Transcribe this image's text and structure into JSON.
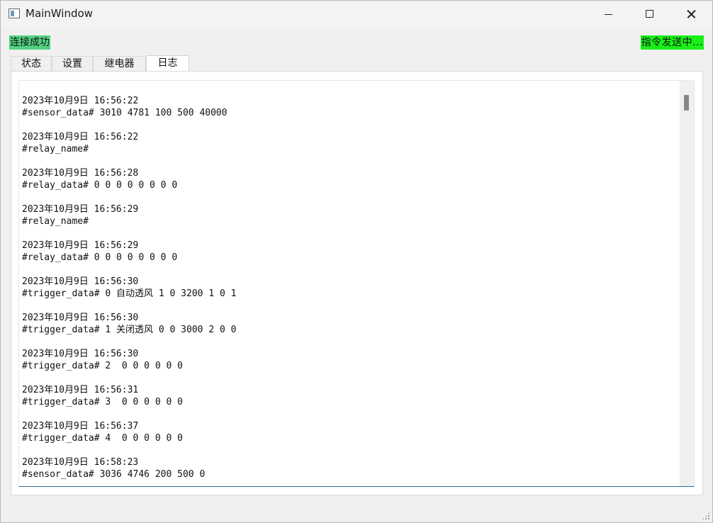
{
  "window": {
    "title": "MainWindow",
    "icon": "app-window-icon"
  },
  "status": {
    "connection": "连接成功",
    "command": "指令发送中...",
    "connection_color": "#52d383",
    "command_color": "#18f018"
  },
  "tabs": [
    {
      "label": "状态",
      "active": false
    },
    {
      "label": "设置",
      "active": false
    },
    {
      "label": "继电器",
      "active": false
    },
    {
      "label": "日志",
      "active": true
    }
  ],
  "log": [
    {
      "time": "2023年10月9日 16:56:22",
      "message": "#sensor_data# 3010 4781 100 500 40000"
    },
    {
      "time": "2023年10月9日 16:56:22",
      "message": "#relay_name#"
    },
    {
      "time": "2023年10月9日 16:56:28",
      "message": "#relay_data# 0 0 0 0 0 0 0 0"
    },
    {
      "time": "2023年10月9日 16:56:29",
      "message": "#relay_name#"
    },
    {
      "time": "2023年10月9日 16:56:29",
      "message": "#relay_data# 0 0 0 0 0 0 0 0"
    },
    {
      "time": "2023年10月9日 16:56:30",
      "message": "#trigger_data# 0 自动透风 1 0 3200 1 0 1"
    },
    {
      "time": "2023年10月9日 16:56:30",
      "message": "#trigger_data# 1 关闭透风 0 0 3000 2 0 0"
    },
    {
      "time": "2023年10月9日 16:56:30",
      "message": "#trigger_data# 2  0 0 0 0 0 0"
    },
    {
      "time": "2023年10月9日 16:56:31",
      "message": "#trigger_data# 3  0 0 0 0 0 0"
    },
    {
      "time": "2023年10月9日 16:56:37",
      "message": "#trigger_data# 4  0 0 0 0 0 0"
    },
    {
      "time": "2023年10月9日 16:58:23",
      "message": "#sensor_data# 3036 4746 200 500 0"
    }
  ]
}
